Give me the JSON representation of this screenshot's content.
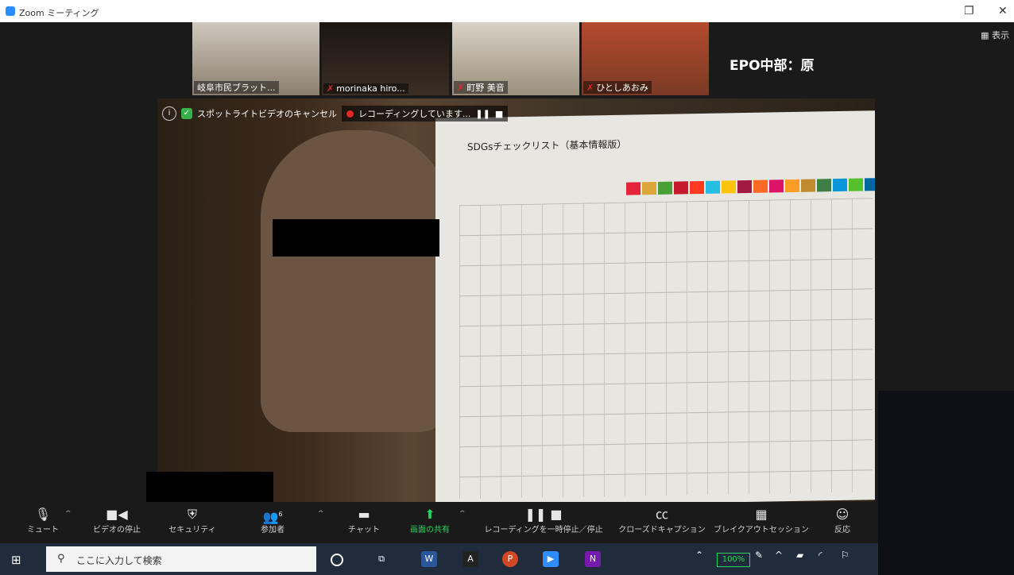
{
  "window": {
    "title": "Zoom ミーティング"
  },
  "header": {
    "view_button": "表示",
    "host_label": "EPO中部：原"
  },
  "participants": [
    {
      "name": "岐阜市民ブラット..."
    },
    {
      "name": "morinaka hiro..."
    },
    {
      "name": "町野 美音"
    },
    {
      "name": "ひとしあおみ"
    }
  ],
  "spotlight": {
    "cancel_label": "スポットライトビデオのキャンセル",
    "recording_label": "レコーディングしています..."
  },
  "sheet": {
    "title": "SDGsチェックリスト（基本情報版）"
  },
  "toolbar": {
    "items": [
      {
        "icon": "microphone-icon",
        "label": "ミュート"
      },
      {
        "icon": "video-camera-icon",
        "label": "ビデオの停止"
      },
      {
        "icon": "shield-icon",
        "label": "セキュリティ"
      },
      {
        "icon": "participants-icon",
        "label": "参加者",
        "count": "6"
      },
      {
        "icon": "chat-icon",
        "label": "チャット"
      },
      {
        "icon": "share-screen-icon",
        "label": "画面の共有"
      },
      {
        "icon": "pause-recording-icon",
        "label": "レコーディングを一時停止／停止"
      },
      {
        "icon": "cc-icon",
        "label": "クローズドキャプション"
      },
      {
        "icon": "breakout-icon",
        "label": "ブレイクアウトセッション"
      },
      {
        "icon": "reaction-icon",
        "label": "反応"
      }
    ]
  },
  "taskbar": {
    "search_placeholder": "ここに入力して検索",
    "battery": "100%"
  },
  "sdg_colors": [
    "#e5243b",
    "#dda63a",
    "#4c9f38",
    "#c5192d",
    "#ff3a21",
    "#26bde2",
    "#fcc30b",
    "#a21942",
    "#fd6925",
    "#dd1367",
    "#fd9d24",
    "#bf8b2e",
    "#3f7e44",
    "#0a97d9",
    "#56c02b",
    "#00689d",
    "#19486a"
  ]
}
